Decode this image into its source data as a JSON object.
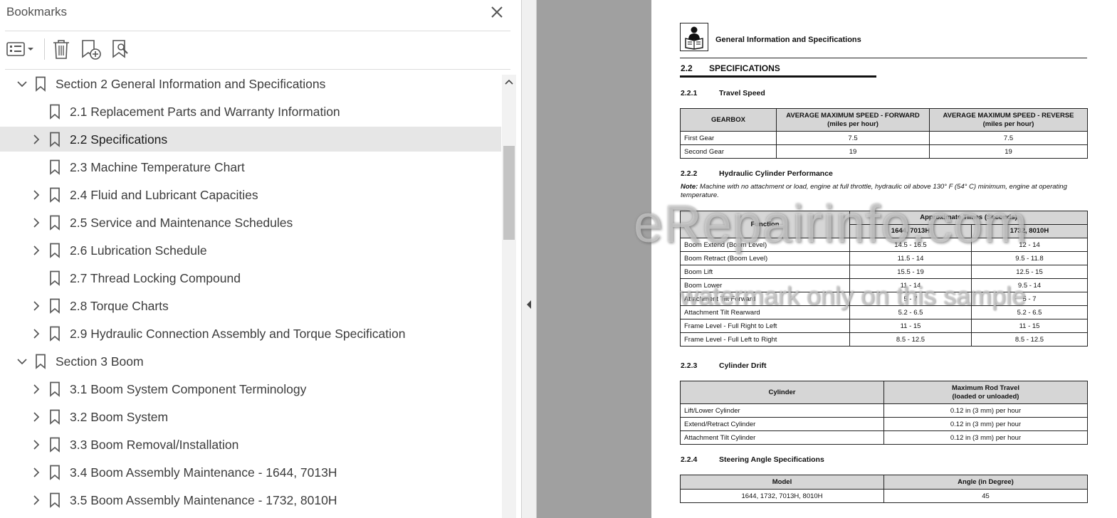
{
  "bookmarks_panel": {
    "title": "Bookmarks",
    "toolbar": {
      "options_icon": "list-options-icon",
      "delete_icon": "trash-icon",
      "add_bookmark_icon": "add-bookmark-icon",
      "find_bookmark_icon": "find-bookmark-icon"
    },
    "items": [
      {
        "label": "Section 2 General Information and Specifications",
        "level": 0,
        "expander": "expanded",
        "selected": false
      },
      {
        "label": "2.1 Replacement Parts and Warranty Information",
        "level": 1,
        "expander": "none",
        "selected": false
      },
      {
        "label": "2.2 Specifications",
        "level": 1,
        "expander": "collapsed",
        "selected": true
      },
      {
        "label": "2.3 Machine Temperature Chart",
        "level": 1,
        "expander": "none",
        "selected": false
      },
      {
        "label": "2.4 Fluid and Lubricant Capacities",
        "level": 1,
        "expander": "collapsed",
        "selected": false
      },
      {
        "label": "2.5 Service and Maintenance Schedules",
        "level": 1,
        "expander": "collapsed",
        "selected": false
      },
      {
        "label": "2.6 Lubrication Schedule",
        "level": 1,
        "expander": "collapsed",
        "selected": false
      },
      {
        "label": "2.7 Thread Locking Compound",
        "level": 1,
        "expander": "none",
        "selected": false
      },
      {
        "label": "2.8 Torque Charts",
        "level": 1,
        "expander": "collapsed",
        "selected": false
      },
      {
        "label": "2.9 Hydraulic Connection Assembly and Torque Specification",
        "level": 1,
        "expander": "collapsed",
        "selected": false
      },
      {
        "label": "Section 3 Boom",
        "level": 0,
        "expander": "expanded",
        "selected": false
      },
      {
        "label": "3.1 Boom System Component Terminology",
        "level": 1,
        "expander": "collapsed",
        "selected": false
      },
      {
        "label": "3.2 Boom System",
        "level": 1,
        "expander": "collapsed",
        "selected": false
      },
      {
        "label": "3.3 Boom Removal/Installation",
        "level": 1,
        "expander": "collapsed",
        "selected": false
      },
      {
        "label": "3.4 Boom Assembly Maintenance - 1644, 7013H",
        "level": 1,
        "expander": "collapsed",
        "selected": false
      },
      {
        "label": "3.5 Boom Assembly Maintenance - 1732, 8010H",
        "level": 1,
        "expander": "collapsed",
        "selected": false
      }
    ]
  },
  "document": {
    "header": "General Information and Specifications",
    "section": {
      "number": "2.2",
      "title": "SPECIFICATIONS"
    },
    "travel_speed": {
      "number": "2.2.1",
      "title": "Travel Speed",
      "headers": [
        "GEARBOX",
        "AVERAGE MAXIMUM SPEED - FORWARD",
        "(miles per hour)",
        "AVERAGE MAXIMUM SPEED - REVERSE",
        "(miles per hour)"
      ],
      "rows": [
        [
          "First Gear",
          "7.5",
          "7.5"
        ],
        [
          "Second Gear",
          "19",
          "19"
        ]
      ]
    },
    "hydraulic": {
      "number": "2.2.2",
      "title": "Hydraulic Cylinder Performance",
      "note_label": "Note:",
      "note_text": " Machine with no attachment or load, engine at full throttle, hydraulic oil above 130° F (54° C) minimum, engine at operating temperature.",
      "headers": [
        "Function",
        "Approximate Times (Seconds)",
        "1644, 7013H",
        "1732, 8010H"
      ],
      "rows": [
        [
          "Boom Extend (Boom Level)",
          "14.5 - 16.5",
          "12 - 14"
        ],
        [
          "Boom Retract (Boom Level)",
          "11.5 - 14",
          "9.5 - 11.8"
        ],
        [
          "Boom Lift",
          "15.5 - 19",
          "12.5 - 15"
        ],
        [
          "Boom Lower",
          "11 - 14",
          "9.5 - 14"
        ],
        [
          "Attachment Tilt Forward",
          "5 - 7",
          "5 - 7"
        ],
        [
          "Attachment Tilt Rearward",
          "5.2 - 6.5",
          "5.2 - 6.5"
        ],
        [
          "Frame Level - Full Right to Left",
          "11 - 15",
          "11 - 15"
        ],
        [
          "Frame Level - Full Left to Right",
          "8.5 - 12.5",
          "8.5 - 12.5"
        ]
      ]
    },
    "cylinder_drift": {
      "number": "2.2.3",
      "title": "Cylinder Drift",
      "headers": [
        "Cylinder",
        "Maximum Rod Travel",
        "(loaded or unloaded)"
      ],
      "rows": [
        [
          "Lift/Lower Cylinder",
          "0.12 in (3 mm) per hour"
        ],
        [
          "Extend/Retract Cylinder",
          "0.12 in (3 mm) per hour"
        ],
        [
          "Attachment Tilt Cylinder",
          "0.12 in (3 mm) per hour"
        ]
      ]
    },
    "steering": {
      "number": "2.2.4",
      "title": "Steering Angle Specifications",
      "headers": [
        "Model",
        "Angle (in Degree)"
      ],
      "rows": [
        [
          "1644, 1732, 7013H, 8010H",
          "45"
        ]
      ]
    }
  },
  "watermark": {
    "line1": "eRepairinfo.com",
    "line2": "watermark only on this sample"
  }
}
